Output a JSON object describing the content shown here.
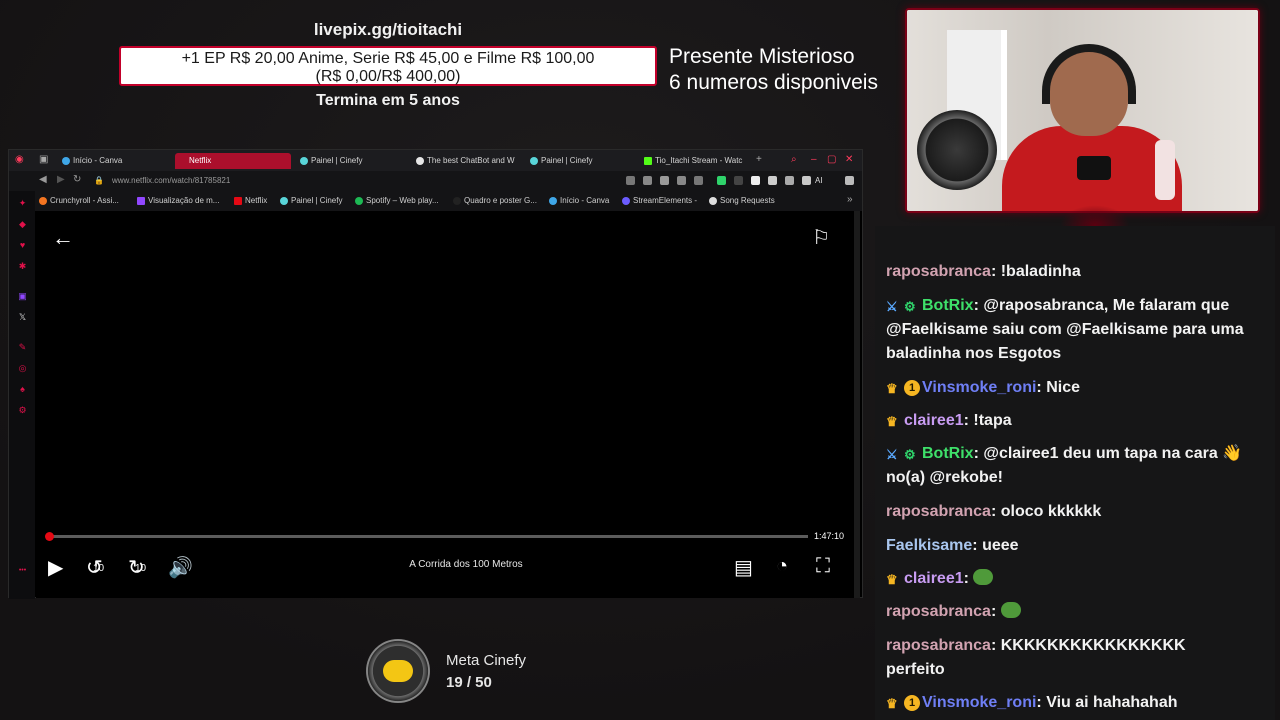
{
  "overlay": {
    "livepix_url": "livepix.gg/tioitachi",
    "goal_line1": "+1 EP R$ 20,00 Anime, Serie R$ 45,00 e Filme R$ 100,00",
    "goal_line2": "(R$ 0,00/R$ 400,00)",
    "ends": "Termina em 5 anos",
    "mystery_line1": "Presente Misterioso",
    "mystery_line2": "6 numeros disponiveis"
  },
  "browser": {
    "tabs": [
      {
        "label": "Início - Canva",
        "active": false
      },
      {
        "label": "Netflix",
        "active": true
      },
      {
        "label": "Painel | Cinefy",
        "active": false
      },
      {
        "label": "The best ChatBot and W",
        "active": false
      },
      {
        "label": "Painel | Cinefy",
        "active": false
      },
      {
        "label": "Tio_Itachi Stream - Watc",
        "active": false
      }
    ],
    "url": "www.netflix.com/watch/81785821",
    "bookmarks": [
      "Crunchyroll - Assi...",
      "Visualização de m...",
      "Netflix",
      "Painel | Cinefy",
      "Spotify – Web play...",
      "Quadro e poster G...",
      "Início - Canva",
      "StreamElements -",
      "Song Requests"
    ],
    "ext_ai_label": "AI"
  },
  "player": {
    "time_left": "1:47:10",
    "title": "A Corrida dos 100 Metros",
    "skip_back": "10",
    "skip_forward": "10",
    "progress_fraction": 0.003
  },
  "goal_widget": {
    "title": "Meta Cinefy",
    "count": "19  /  50"
  },
  "chat": {
    "messages": [
      {
        "user": "raposabranca",
        "color": "#d2a3b1",
        "badges": [],
        "text": "!baladinha"
      },
      {
        "user": "BotRix",
        "color": "#3ee06a",
        "badges": [
          "sword",
          "gear"
        ],
        "text": "@raposabranca, Me falaram que @Faelkisame saiu com @Faelkisame para uma baladinha nos Esgotos"
      },
      {
        "user": "Vinsmoke_roni",
        "color": "#6f7ff5",
        "badges": [
          "crown",
          "sub"
        ],
        "text": "Nice"
      },
      {
        "user": "clairee1",
        "color": "#c89cf2",
        "badges": [
          "crown"
        ],
        "text": "!tapa"
      },
      {
        "user": "BotRix",
        "color": "#3ee06a",
        "badges": [
          "sword",
          "gear"
        ],
        "text": "@clairee1 deu um tapa na cara 👋 no(a) @rekobe!"
      },
      {
        "user": "raposabranca",
        "color": "#d2a3b1",
        "badges": [],
        "text": "oloco kkkkkk"
      },
      {
        "user": "Faelkisame",
        "color": "#a9c6ee",
        "badges": [],
        "text": "ueee"
      },
      {
        "user": "clairee1",
        "color": "#c89cf2",
        "badges": [
          "crown"
        ],
        "text": ""
      },
      {
        "user": "raposabranca",
        "color": "#d2a3b1",
        "badges": [],
        "text": ""
      },
      {
        "user": "raposabranca",
        "color": "#d2a3b1",
        "badges": [],
        "text": "KKKKKKKKKKKKKKKK perfeito"
      },
      {
        "user": "Vinsmoke_roni",
        "color": "#6f7ff5",
        "badges": [
          "crown",
          "sub"
        ],
        "text": "Viu ai hahahahah"
      }
    ]
  }
}
